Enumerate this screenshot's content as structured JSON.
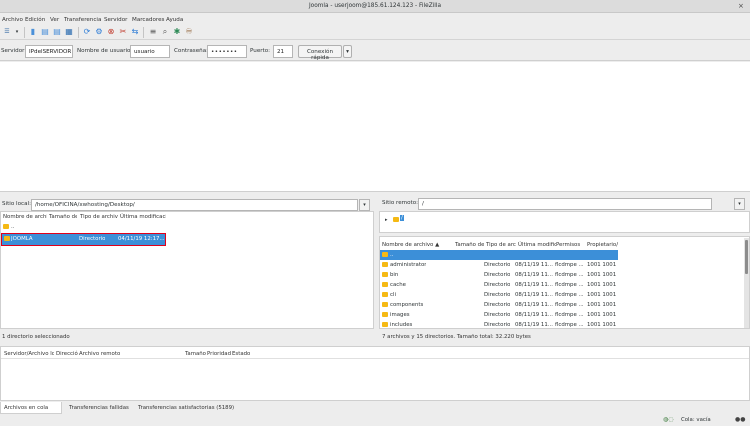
{
  "window": {
    "title": "Joomla - userjoom@185.61.124.123 - FileZilla",
    "close_glyph": "×"
  },
  "menu": [
    "Archivo",
    "Edición",
    "Ver",
    "Transferencia",
    "Servidor",
    "Marcadores",
    "Ayuda"
  ],
  "quickconnect": {
    "server_label": "Servidor:",
    "server_value": "IPdelSERVIDOR",
    "user_label": "Nombre de usuario:",
    "user_value": "usuario",
    "password_label": "Contraseña:",
    "password_value": "•••••••",
    "port_label": "Puerto:",
    "port_value": "21",
    "connect_label": "Conexión rápida",
    "dropdown_glyph": "▾"
  },
  "local": {
    "path_label": "Sitio local:",
    "path_value": "/home/OFICINA/xwhosting/Desktop/",
    "columns": [
      "Nombre de archivo",
      "Tamaño de",
      "Tipo de archivo",
      "Última modificación"
    ],
    "parent": "..",
    "rows": [
      {
        "name": "JOOMLA",
        "type": "Directorio",
        "modified": "04/11/19 12:17..."
      }
    ],
    "status": "1 directorio seleccionado"
  },
  "remote": {
    "path_label": "Sitio remoto:",
    "path_value": "/",
    "tree_root": "/",
    "columns": [
      "Nombre de archivo",
      "Tamaño de",
      "Tipo de archivo",
      "Última modificación",
      "Permisos",
      "Propietario/"
    ],
    "sort_glyph": "▲",
    "parent": "..",
    "rows": [
      {
        "name": "administrator",
        "type": "Directorio",
        "modified": "08/11/19 11...",
        "perms": "flcdmpe ...",
        "owner": "1001 1001"
      },
      {
        "name": "bin",
        "type": "Directorio",
        "modified": "08/11/19 11...",
        "perms": "flcdmpe ...",
        "owner": "1001 1001"
      },
      {
        "name": "cache",
        "type": "Directorio",
        "modified": "08/11/19 11...",
        "perms": "flcdmpe ...",
        "owner": "1001 1001"
      },
      {
        "name": "cli",
        "type": "Directorio",
        "modified": "08/11/19 11...",
        "perms": "flcdmpe ...",
        "owner": "1001 1001"
      },
      {
        "name": "components",
        "type": "Directorio",
        "modified": "08/11/19 11...",
        "perms": "flcdmpe ...",
        "owner": "1001 1001"
      },
      {
        "name": "images",
        "type": "Directorio",
        "modified": "08/11/19 11...",
        "perms": "flcdmpe ...",
        "owner": "1001 1001"
      },
      {
        "name": "includes",
        "type": "Directorio",
        "modified": "08/11/19 11...",
        "perms": "flcdmpe ...",
        "owner": "1001 1001"
      }
    ],
    "status": "7 archivos y 15 directorios. Tamaño total: 32.220 bytes"
  },
  "queue": {
    "columns": [
      "Servidor/Archivo local",
      "Dirección",
      "Archivo remoto",
      "Tamaño",
      "Prioridad",
      "Estado"
    ],
    "tabs": [
      "Archivos en cola",
      "Transferencias fallidas",
      "Transferencias satisfactorias (5189)"
    ],
    "status_text": "Cola: vacía"
  },
  "colors": {
    "selection": "#3c8fd8",
    "highlight_border": "#e0001b",
    "folder": "#f5b914"
  }
}
